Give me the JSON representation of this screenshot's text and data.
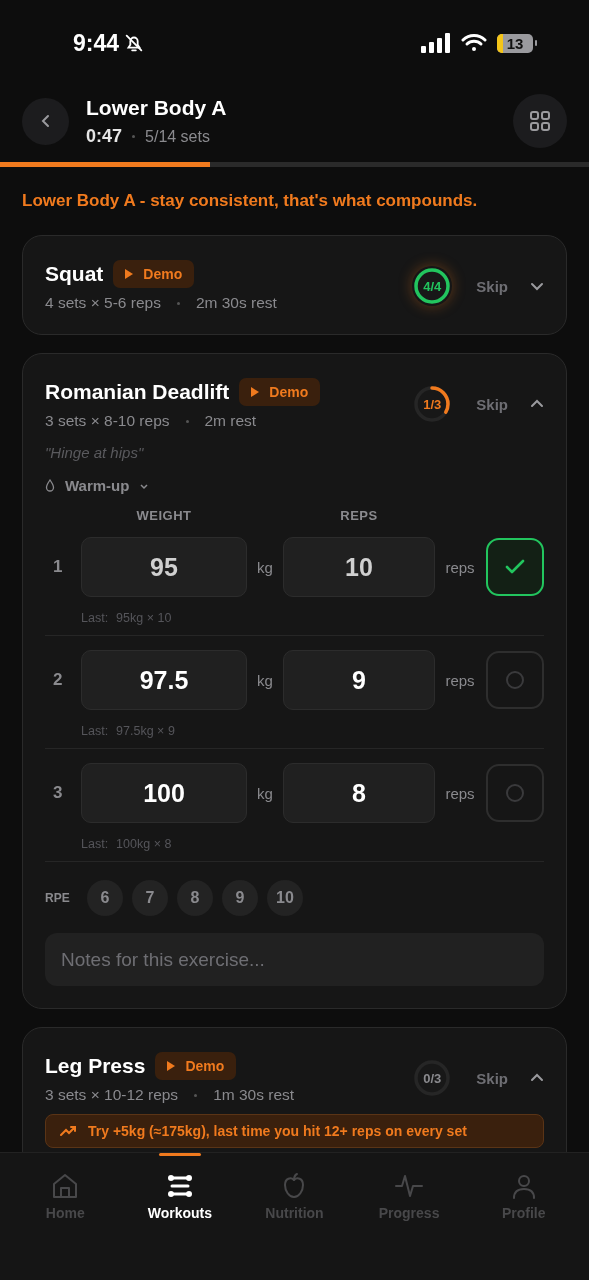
{
  "status_bar": {
    "time": "9:44",
    "battery": "13"
  },
  "header": {
    "title": "Lower Body A",
    "timer": "0:47",
    "sets": "5/14 sets",
    "progress": {
      "level": 0.357
    }
  },
  "motivation": "Lower Body A - stay consistent, that's what compounds.",
  "exercises": [
    {
      "name": "Squat",
      "demo": "Demo",
      "details": [
        "4 sets × 5-6 reps",
        "2m 30s rest"
      ],
      "progress": "4/4",
      "kind": "complete",
      "skip": "Skip",
      "expanded": false
    },
    {
      "name": "Romanian Deadlift",
      "demo": "Demo",
      "details": [
        "3 sets × 8-10 reps",
        "2m rest"
      ],
      "progress": "1/3",
      "kind": "partial",
      "skip": "Skip",
      "expanded": true,
      "cue": "\"Hinge at hips\"",
      "warmup": "Warm-up",
      "columns": [
        "WEIGHT",
        "REPS"
      ],
      "sets": [
        {
          "number": "1",
          "weight": "95",
          "weight_unit": "kg",
          "reps": "10",
          "reps_unit": "reps",
          "done": true,
          "last_label": "Last:",
          "last_value": "95kg × 10"
        },
        {
          "number": "2",
          "weight": "97.5",
          "weight_unit": "kg",
          "reps": "9",
          "reps_unit": "reps",
          "done": false,
          "last_label": "Last:",
          "last_value": "97.5kg × 9"
        },
        {
          "number": "3",
          "weight": "100",
          "weight_unit": "kg",
          "reps": "8",
          "reps_unit": "reps",
          "done": false,
          "last_label": "Last:",
          "last_value": "100kg × 8"
        }
      ],
      "rpe_label": "RPE",
      "rpe": [
        {
          "label": "6",
          "selected": false
        },
        {
          "label": "7",
          "selected": false
        },
        {
          "label": "8",
          "selected": false
        },
        {
          "label": "9",
          "selected": false
        },
        {
          "label": "10",
          "selected": false
        }
      ],
      "notes_placeholder": "Notes for this exercise..."
    },
    {
      "name": "Leg Press",
      "demo": "Demo",
      "details": [
        "3 sets × 10-12 reps",
        "1m 30s rest"
      ],
      "progress": "0/3",
      "kind": "empty",
      "skip": "Skip",
      "expanded": true,
      "hint": "Try +5kg (≈175kg), last time you hit 12+ reps on every set"
    }
  ],
  "tabs": [
    {
      "label": "Home",
      "selected": false
    },
    {
      "label": "Workouts",
      "selected": true
    },
    {
      "label": "Nutrition",
      "selected": false
    },
    {
      "label": "Progress",
      "selected": false
    },
    {
      "label": "Profile",
      "selected": false
    }
  ]
}
